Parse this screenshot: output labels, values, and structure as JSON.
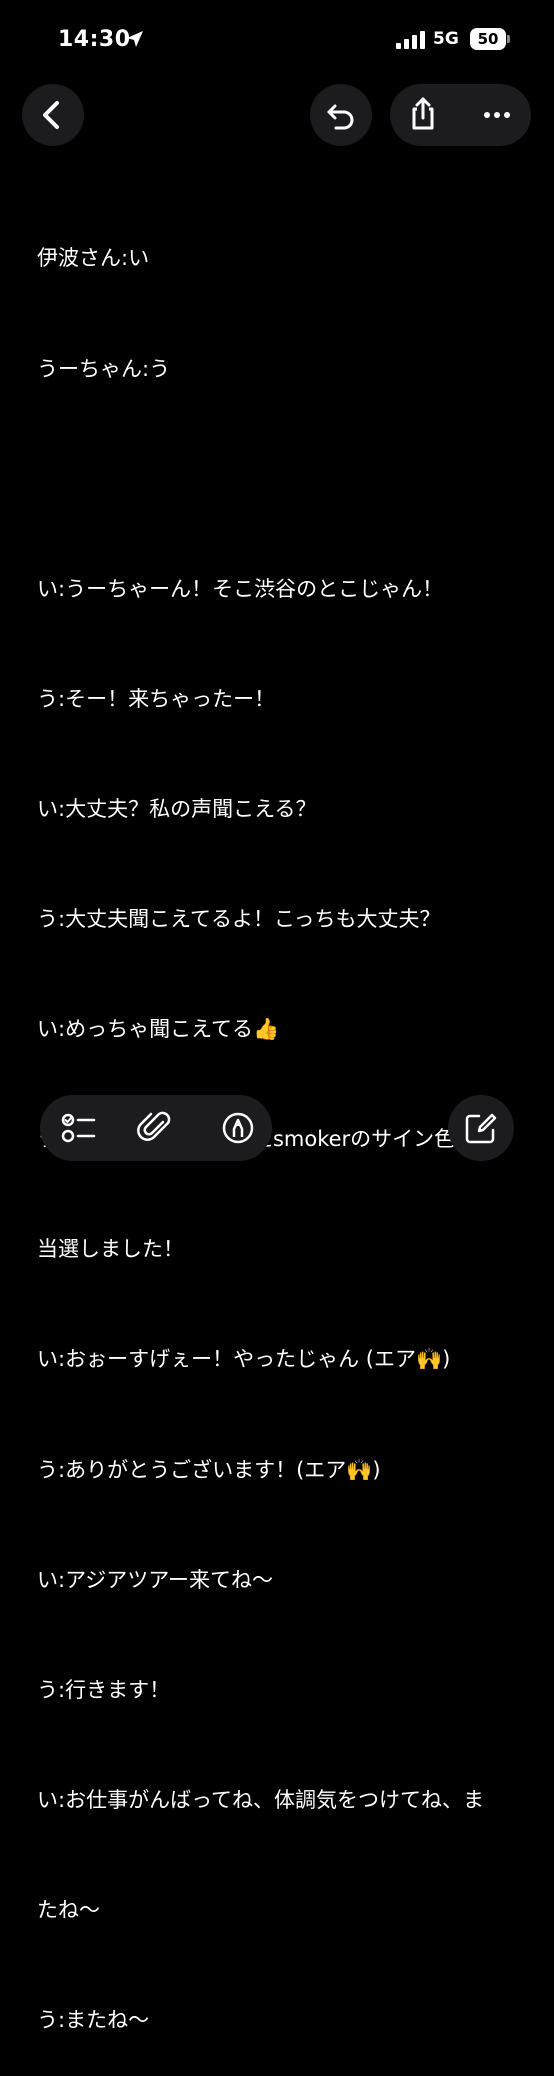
{
  "status_bar": {
    "time": "14:30",
    "network": "5G",
    "battery": "50"
  },
  "nav": {
    "icons": [
      "chevron-left-icon",
      "undo-icon",
      "share-icon",
      "more-icon"
    ]
  },
  "note": {
    "lines": [
      "伊波さん:い",
      "うーちゃん:う",
      "",
      "い:うーちゃーん！そこ渋谷のとこじゃん！",
      "う:そー！来ちゃったー！",
      "い:大丈夫？私の声聞こえる？",
      "う:大丈夫聞こえてるよ！こっちも大丈夫？",
      "い:めっちゃ聞こえてる👍",
      "う:ゲーマーズでやってたsmokerのサイン色紙",
      "当選しました！",
      "い:おぉーすげぇー！やったじゃん (エア🙌)",
      "う:ありがとうございます！(エア🙌)",
      "い:アジアツアー来てね〜",
      "う:行きます！",
      "い:お仕事がんばってね、体調気をつけてね、ま",
      "たね〜",
      "う:またね〜"
    ]
  },
  "toolbar": {
    "icons": [
      "checklist-icon",
      "paperclip-icon",
      "markup-icon",
      "compose-icon"
    ]
  },
  "colors": {
    "background": "#000000",
    "button_bg": "#1c1c1e",
    "text": "#ffffff"
  }
}
